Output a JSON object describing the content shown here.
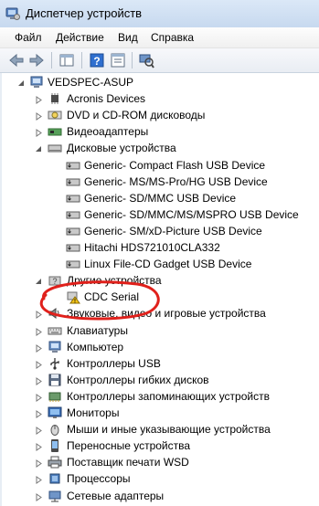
{
  "window": {
    "title": "Диспетчер устройств"
  },
  "menu": [
    "Файл",
    "Действие",
    "Вид",
    "Справка"
  ],
  "tree": {
    "root": "VEDSPEC-ASUP",
    "categories": [
      {
        "label": "Acronis Devices",
        "icon": "chip-icon",
        "expanded": false
      },
      {
        "label": "DVD и CD-ROM дисководы",
        "icon": "dvd-drive-icon",
        "expanded": false
      },
      {
        "label": "Видеоадаптеры",
        "icon": "display-adapter-icon",
        "expanded": false
      },
      {
        "label": "Дисковые устройства",
        "icon": "disk-drive-icon",
        "expanded": true,
        "children": [
          "Generic- Compact Flash USB Device",
          "Generic- MS/MS-Pro/HG USB Device",
          "Generic- SD/MMC USB Device",
          "Generic- SD/MMC/MS/MSPRO USB Device",
          "Generic- SM/xD-Picture USB Device",
          "Hitachi HDS721010CLA332",
          "Linux File-CD Gadget USB Device"
        ]
      },
      {
        "label": "Другие устройства",
        "icon": "unknown-device-icon",
        "expanded": true,
        "children": [
          "CDC Serial"
        ]
      },
      {
        "label": "Звуковые, видео и игровые устройства",
        "icon": "speaker-icon",
        "expanded": false
      },
      {
        "label": "Клавиатуры",
        "icon": "keyboard-icon",
        "expanded": false
      },
      {
        "label": "Компьютер",
        "icon": "computer-icon",
        "expanded": false
      },
      {
        "label": "Контроллеры USB",
        "icon": "usb-icon",
        "expanded": false
      },
      {
        "label": "Контроллеры гибких дисков",
        "icon": "floppy-controller-icon",
        "expanded": false
      },
      {
        "label": "Контроллеры запоминающих устройств",
        "icon": "storage-controller-icon",
        "expanded": false
      },
      {
        "label": "Мониторы",
        "icon": "monitor-icon",
        "expanded": false
      },
      {
        "label": "Мыши и иные указывающие устройства",
        "icon": "mouse-icon",
        "expanded": false
      },
      {
        "label": "Переносные устройства",
        "icon": "portable-device-icon",
        "expanded": false
      },
      {
        "label": "Поставщик печати WSD",
        "icon": "printer-icon",
        "expanded": false
      },
      {
        "label": "Процессоры",
        "icon": "processor-icon",
        "expanded": false
      },
      {
        "label": "Сетевые адаптеры",
        "icon": "network-adapter-icon",
        "expanded": false
      }
    ]
  },
  "annotation": {
    "color": "#e0201b",
    "target": "CDC Serial"
  }
}
